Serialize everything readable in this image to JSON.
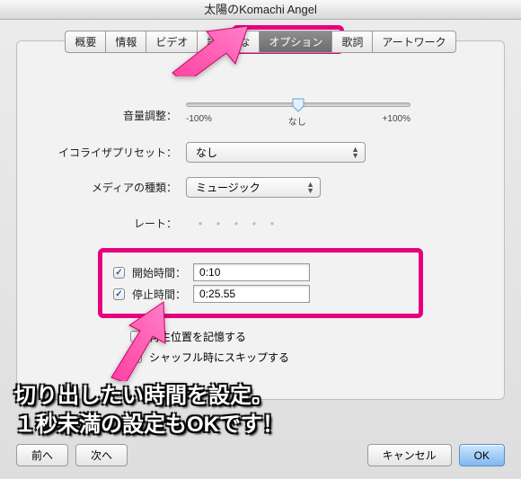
{
  "window": {
    "title": "太陽のKomachi Angel"
  },
  "tabs": [
    {
      "label": "概要"
    },
    {
      "label": "情報"
    },
    {
      "label": "ビデオ"
    },
    {
      "label": "読みがな"
    },
    {
      "label": "オプション"
    },
    {
      "label": "歌詞"
    },
    {
      "label": "アートワーク"
    }
  ],
  "volume": {
    "label": "音量調整：",
    "min": "-100%",
    "mid": "なし",
    "max": "+100%"
  },
  "eq": {
    "label": "イコライザプリセット：",
    "value": "なし"
  },
  "media": {
    "label": "メディアの種類：",
    "value": "ミュージック"
  },
  "rate": {
    "label": "レート：",
    "dots": "・・・・・"
  },
  "start": {
    "label": "開始時間：",
    "value": "0:10"
  },
  "stop": {
    "label": "停止時間：",
    "value": "0:25.55"
  },
  "remember": {
    "label": "再生位置を記憶する"
  },
  "shuffle": {
    "label": "シャッフル時にスキップする"
  },
  "buttons": {
    "prev": "前へ",
    "next": "次へ",
    "cancel": "キャンセル",
    "ok": "OK"
  },
  "caption": {
    "line1": "切り出したい時間を設定。",
    "line2": "１秒未満の設定もOKです！"
  }
}
